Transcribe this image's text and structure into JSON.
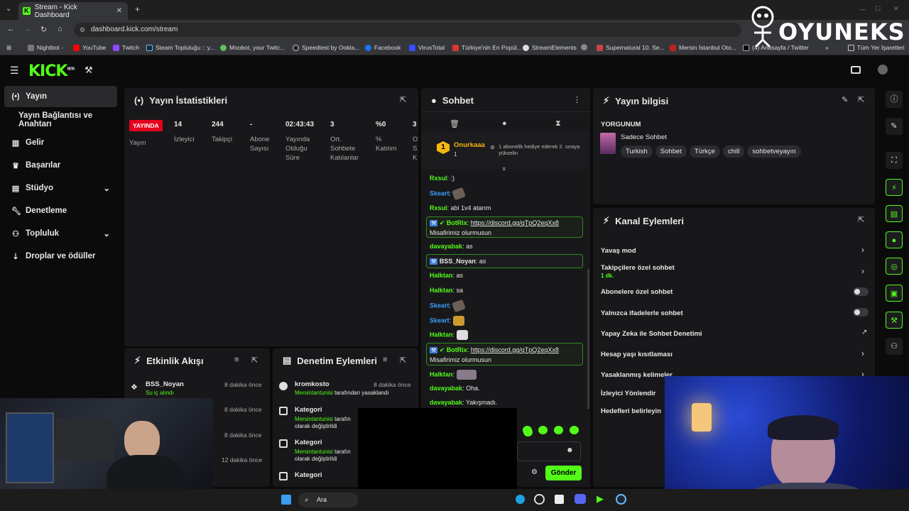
{
  "browser": {
    "tab_title": "Stream - Kick Dashboard",
    "url": "dashboard.kick.com/stream",
    "bookmarks": [
      "Nightbot -",
      "YouTube",
      "Twitch",
      "Steam Topluluğu :: y...",
      "Moobot, your Twitc...",
      "Speedtest by Ookla...",
      "Facebook",
      "VirusTotal",
      "Türkiye'nin En Popül...",
      "StreamElements",
      "Supernatural 10. Se...",
      "Mersin İstanbul Oto...",
      "(4) Anasayfa / Twitter"
    ],
    "bookmarks_folder": "Tüm Yer İşaretleri"
  },
  "watermark": "OYUNEKS",
  "kick": {
    "logo": "KICK",
    "beta": "BETA"
  },
  "sidebar": {
    "items": [
      {
        "label": "Yayın",
        "icon": "broadcast-icon"
      },
      {
        "label": "Yayın Bağlantısı ve Anahtarı",
        "icon": ""
      },
      {
        "label": "Gelir",
        "icon": "chart-icon"
      },
      {
        "label": "Başarılar",
        "icon": "trophy-icon"
      },
      {
        "label": "Stüdyo",
        "icon": "studio-icon"
      },
      {
        "label": "Denetleme",
        "icon": "wrench-icon"
      },
      {
        "label": "Topluluk",
        "icon": "community-icon"
      },
      {
        "label": "Droplar ve ödüller",
        "icon": "drops-icon"
      }
    ]
  },
  "stats": {
    "title": "Yayın İstatistikleri",
    "live_badge": "YAYINDA",
    "live_label": "Yayın",
    "items": [
      {
        "value": "14",
        "label": "İzleyici"
      },
      {
        "value": "244",
        "label": "Takipçi"
      },
      {
        "value": "-",
        "label": "Abone Sayısı"
      },
      {
        "value": "02:43:43",
        "label": "Yayında Olduğu Süre"
      },
      {
        "value": "3",
        "label": "Ort. Sohbete Katılanlar"
      },
      {
        "value": "%0",
        "label": "% Katılım"
      },
      {
        "value": "3",
        "label": "O S K"
      }
    ]
  },
  "chat": {
    "title": "Sohbet",
    "pinned_user": "Onurkaaa",
    "pinned_rank": "1",
    "pinned_count": "1",
    "pinned_note": "1 abonelik hediye ederek 2. sıraya yükselin",
    "messages": [
      {
        "user": "Rxsul",
        "text": ":)",
        "color": "#53fc18"
      },
      {
        "user": "Skeart",
        "text": "",
        "color": "#3b9cff"
      },
      {
        "user": "Rxsul",
        "text": "abi 1v4 atarım",
        "color": "#53fc18"
      },
      {
        "user": "BotRix",
        "link": "https://discord.gg/qTpQ2eqXx8",
        "text": "Misafirimiz olurmusun",
        "color": "#53fc18"
      },
      {
        "user": "davayabak",
        "text": "as",
        "color": "#53fc18"
      },
      {
        "user": "BSS_Noyan",
        "text": "as",
        "color": "#e8e8e8"
      },
      {
        "user": "Halktan",
        "text": "as",
        "color": "#53fc18"
      },
      {
        "user": "Halktan",
        "text": "sa",
        "color": "#53fc18"
      },
      {
        "user": "Skeart",
        "text": "",
        "color": "#3b9cff"
      },
      {
        "user": "Skeart",
        "text": "",
        "color": "#3b9cff"
      },
      {
        "user": "Halktan",
        "text": "",
        "color": "#53fc18"
      },
      {
        "user": "BotRix",
        "link": "https://discord.gg/qTpQ2eqXx8",
        "text": "Misafirimiz olurmusun",
        "color": "#53fc18"
      },
      {
        "user": "Halktan",
        "text": "",
        "color": "#53fc18"
      },
      {
        "user": "davayabak",
        "text": "Oha.",
        "color": "#53fc18"
      },
      {
        "user": "davayabak",
        "text": "Yakışmadı.",
        "color": "#53fc18"
      }
    ],
    "send_label": "Gönder"
  },
  "stream_info": {
    "title": "Yayın bilgisi",
    "stream_title": "YORGUNUM",
    "category": "Sadece Sohbet",
    "tags": [
      "Turkish",
      "Sohbet",
      "Türkçe",
      "chill",
      "sohbetveyayın"
    ]
  },
  "channel_actions": {
    "title": "Kanal Eylemleri",
    "rows": [
      {
        "label": "Yavaş mod",
        "control": "arrow"
      },
      {
        "label": "Takipçilere özel sohbet",
        "sub": "1 dk.",
        "control": "arrow"
      },
      {
        "label": "Abonelere özel sohbet",
        "control": "toggle"
      },
      {
        "label": "Yalnızca ifadelerle sohbet",
        "control": "toggle"
      },
      {
        "label": "Yapay Zeka ile Sohbet Denetimi",
        "control": "external"
      },
      {
        "label": "Hesap yaşı kısıtlaması",
        "control": "arrow"
      },
      {
        "label": "Yasaklanmış kelimeler",
        "control": "arrow"
      },
      {
        "label": "İzleyici Yönlendir",
        "control": "none"
      },
      {
        "label": "Hedefleri belirleyin",
        "control": "none"
      }
    ]
  },
  "activity": {
    "title": "Etkinlik Akışı",
    "items": [
      {
        "user": "BSS_Noyan",
        "action": "Su iç alındı",
        "time": "8 dakika önce"
      },
      {
        "user": "",
        "action": "",
        "time": "8 dakika önce"
      },
      {
        "user": "",
        "action": "",
        "time": "8 dakika önce"
      },
      {
        "user": "",
        "action": "",
        "time": "12 dakika önce"
      }
    ]
  },
  "moderation": {
    "title": "Denetim Eylemleri",
    "items": [
      {
        "title": "kromkosto",
        "actor": "Mersintantunisi",
        "rest": "tarafından yasaklandı",
        "time": "8 dakika önce"
      },
      {
        "title": "Kategori",
        "actor": "Mersintantunisi",
        "rest": "tarafın olarak değiştirildi",
        "time": ""
      },
      {
        "title": "Kategori",
        "actor": "Mersintantunisi",
        "rest": "tarafın olarak değiştirildi",
        "time": ""
      },
      {
        "title": "Kategori",
        "actor": "",
        "rest": "",
        "time": ""
      }
    ]
  },
  "taskbar": {
    "search": "Ara"
  }
}
